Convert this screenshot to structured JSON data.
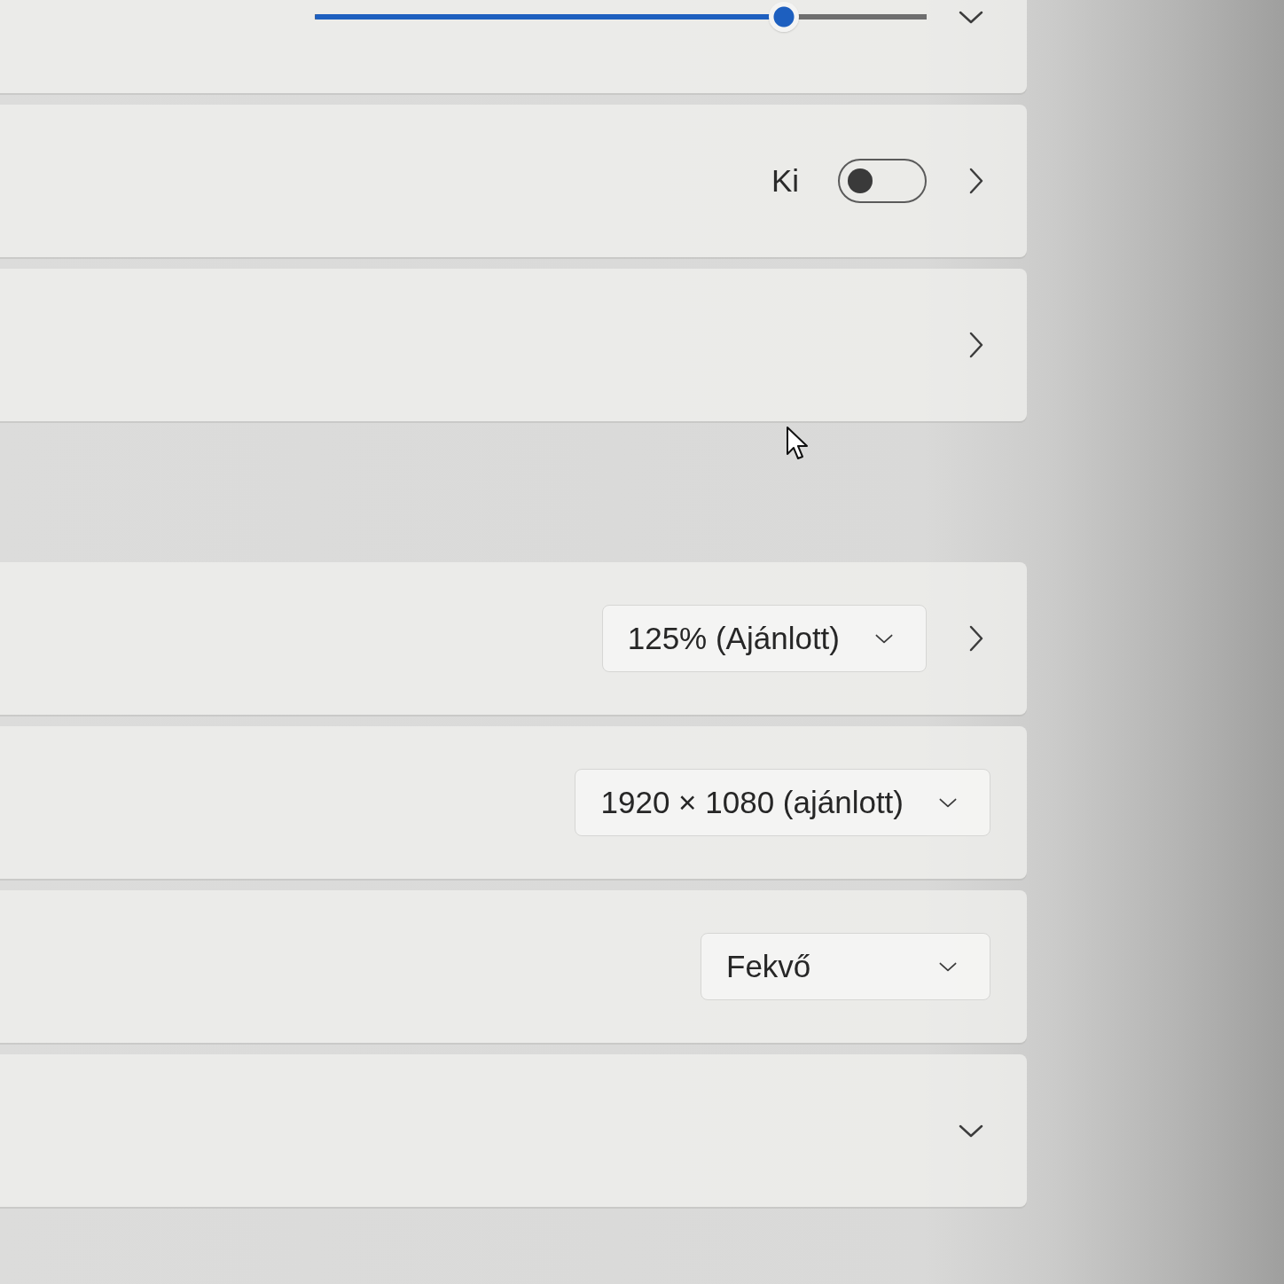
{
  "groups": [
    {
      "rows": [
        {
          "kind": "slider",
          "level": 0.78,
          "navigable": false,
          "expandable": true
        },
        {
          "kind": "toggle",
          "state_label": "Ki",
          "on": false,
          "navigable": true,
          "expandable": false
        },
        {
          "kind": "plain",
          "navigable": true,
          "expandable": false
        }
      ]
    },
    {
      "rows": [
        {
          "kind": "dropdown",
          "value": "125% (Ajánlott)",
          "navigable": true,
          "expandable": false
        },
        {
          "kind": "dropdown",
          "value": "1920 × 1080 (ajánlott)",
          "navigable": false,
          "expandable": false
        },
        {
          "kind": "dropdown",
          "value": "Fekvő",
          "navigable": false,
          "expandable": false
        },
        {
          "kind": "plain",
          "navigable": false,
          "expandable": true
        }
      ]
    }
  ]
}
